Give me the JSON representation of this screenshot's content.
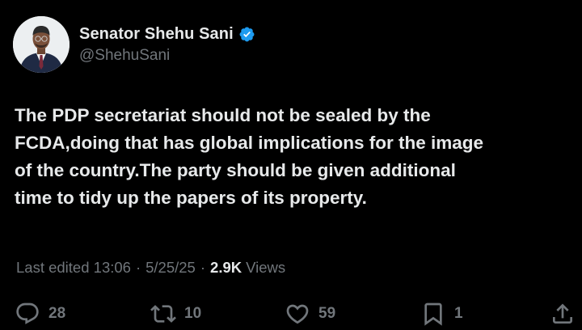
{
  "author": {
    "display_name": "Senator Shehu Sani",
    "handle": "@ShehuSani",
    "verified": true,
    "avatar_icon": "profile-photo"
  },
  "post": {
    "text": "The PDP secretariat should not be sealed by the\nFCDA,doing that has global implications for the image\nof the country.The party should be given additional\ntime to tidy up the papers of its property."
  },
  "meta": {
    "edited_prefix": "Last edited",
    "time": "13:06",
    "date": "5/25/25",
    "separator": "·",
    "views_count": "2.9K",
    "views_label": "Views"
  },
  "actions": {
    "replies": "28",
    "reposts": "10",
    "likes": "59",
    "bookmarks": "1"
  },
  "colors": {
    "background": "#000000",
    "primary_text": "#e7e9ea",
    "secondary_text": "#71767b",
    "verified_badge": "#1d9bf0"
  }
}
